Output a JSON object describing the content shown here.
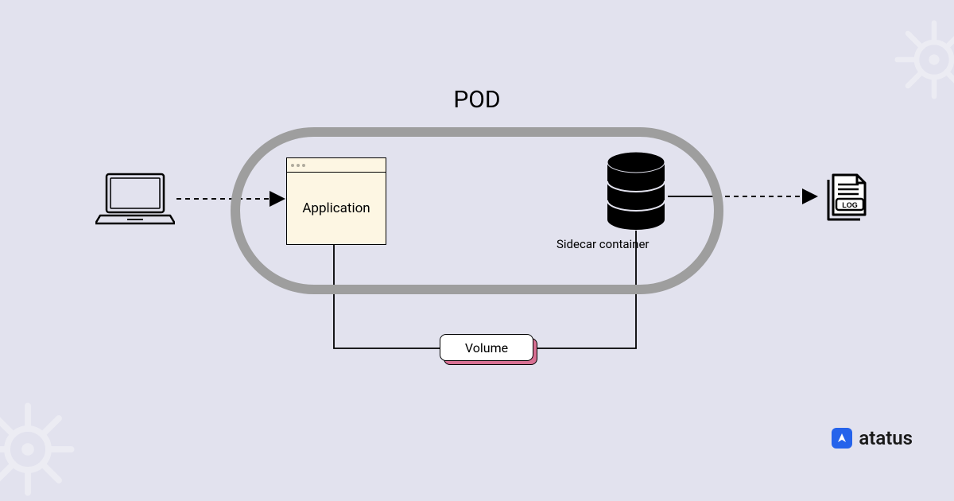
{
  "title": "POD",
  "application_label": "Application",
  "sidecar_label": "Sidecar container",
  "volume_label": "Volume",
  "log_label": "LOG",
  "brand_name": "atatus",
  "colors": {
    "background": "#e2e2ee",
    "pod_border": "#9e9e9e",
    "application_fill": "#fdf6e3",
    "volume_shadow": "#d87093",
    "brand_blue": "#2563eb"
  }
}
